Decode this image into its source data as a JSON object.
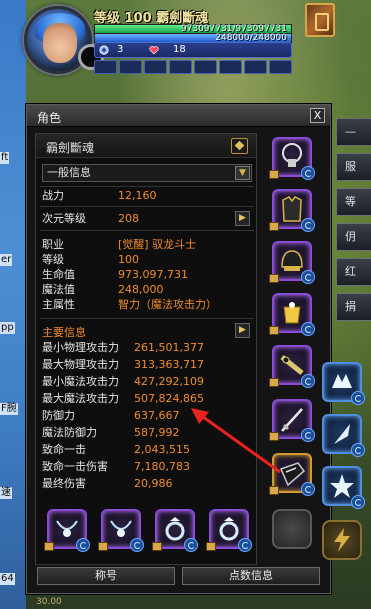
{
  "hud": {
    "level_title": "等级 100  霸劍斷魂",
    "hp_text": "973097731/973097731",
    "mp_text": "248000/248000",
    "fatigue_value": "3",
    "heart_value": "18"
  },
  "side_tabs": [
    "—",
    "服",
    "等",
    "仴",
    "红",
    "捐"
  ],
  "left_fragments": [
    "ft",
    "er",
    "pp",
    "F腕",
    "速",
    "64"
  ],
  "window": {
    "title": "角色",
    "close_label": "X",
    "character_name": "霸劍斷魂",
    "dropdown_value": "一般信息",
    "general": [
      {
        "label": "战力",
        "value": "12,160"
      },
      {
        "label": "次元等级",
        "value": "208"
      }
    ],
    "profile": [
      {
        "label": "职业",
        "value": "[觉醒] 驭龙斗士"
      },
      {
        "label": "等级",
        "value": "100"
      },
      {
        "label": "生命值",
        "value": "973,097,731"
      },
      {
        "label": "魔法值",
        "value": "248,000"
      },
      {
        "label": "主属性",
        "value": "智力（魔法攻击力）"
      }
    ],
    "main_info_title": "主要信息",
    "main_info": [
      {
        "label": "最小物理攻击力",
        "value": "261,501,377"
      },
      {
        "label": "最大物理攻击力",
        "value": "313,363,717"
      },
      {
        "label": "最小魔法攻击力",
        "value": "427,292,109"
      },
      {
        "label": "最大魔法攻击力",
        "value": "507,824,865"
      },
      {
        "label": "防御力",
        "value": "637,667"
      },
      {
        "label": "魔法防御力",
        "value": "587,992"
      },
      {
        "label": "致命一击",
        "value": "2,043,515"
      },
      {
        "label": "致命一击伤害",
        "value": "7,180,783"
      },
      {
        "label": "最终伤害",
        "value": "20,986"
      }
    ],
    "bottom_buttons": [
      "称号",
      "点数信息"
    ],
    "bottom_fragment": "30.00"
  },
  "colors": {
    "value_orange": "#f08c2c",
    "purple_border": "#8a4bd6",
    "hp_green": "#39d86a",
    "mp_blue": "#3a8bff"
  },
  "icons": {
    "equipment": [
      "necklace-icon",
      "armor-icon",
      "helmet-icon",
      "bracelet-icon",
      "belt-icon",
      "sword-icon",
      "gauntlet-icon"
    ],
    "accessories": [
      "amulet-icon",
      "amulet-icon",
      "ring-icon",
      "ring-icon"
    ],
    "skill_slots": [
      "crest-icon",
      "blade-icon",
      "star-crest-icon"
    ]
  },
  "hp_fill": 1.0,
  "mp_fill": 1.0
}
